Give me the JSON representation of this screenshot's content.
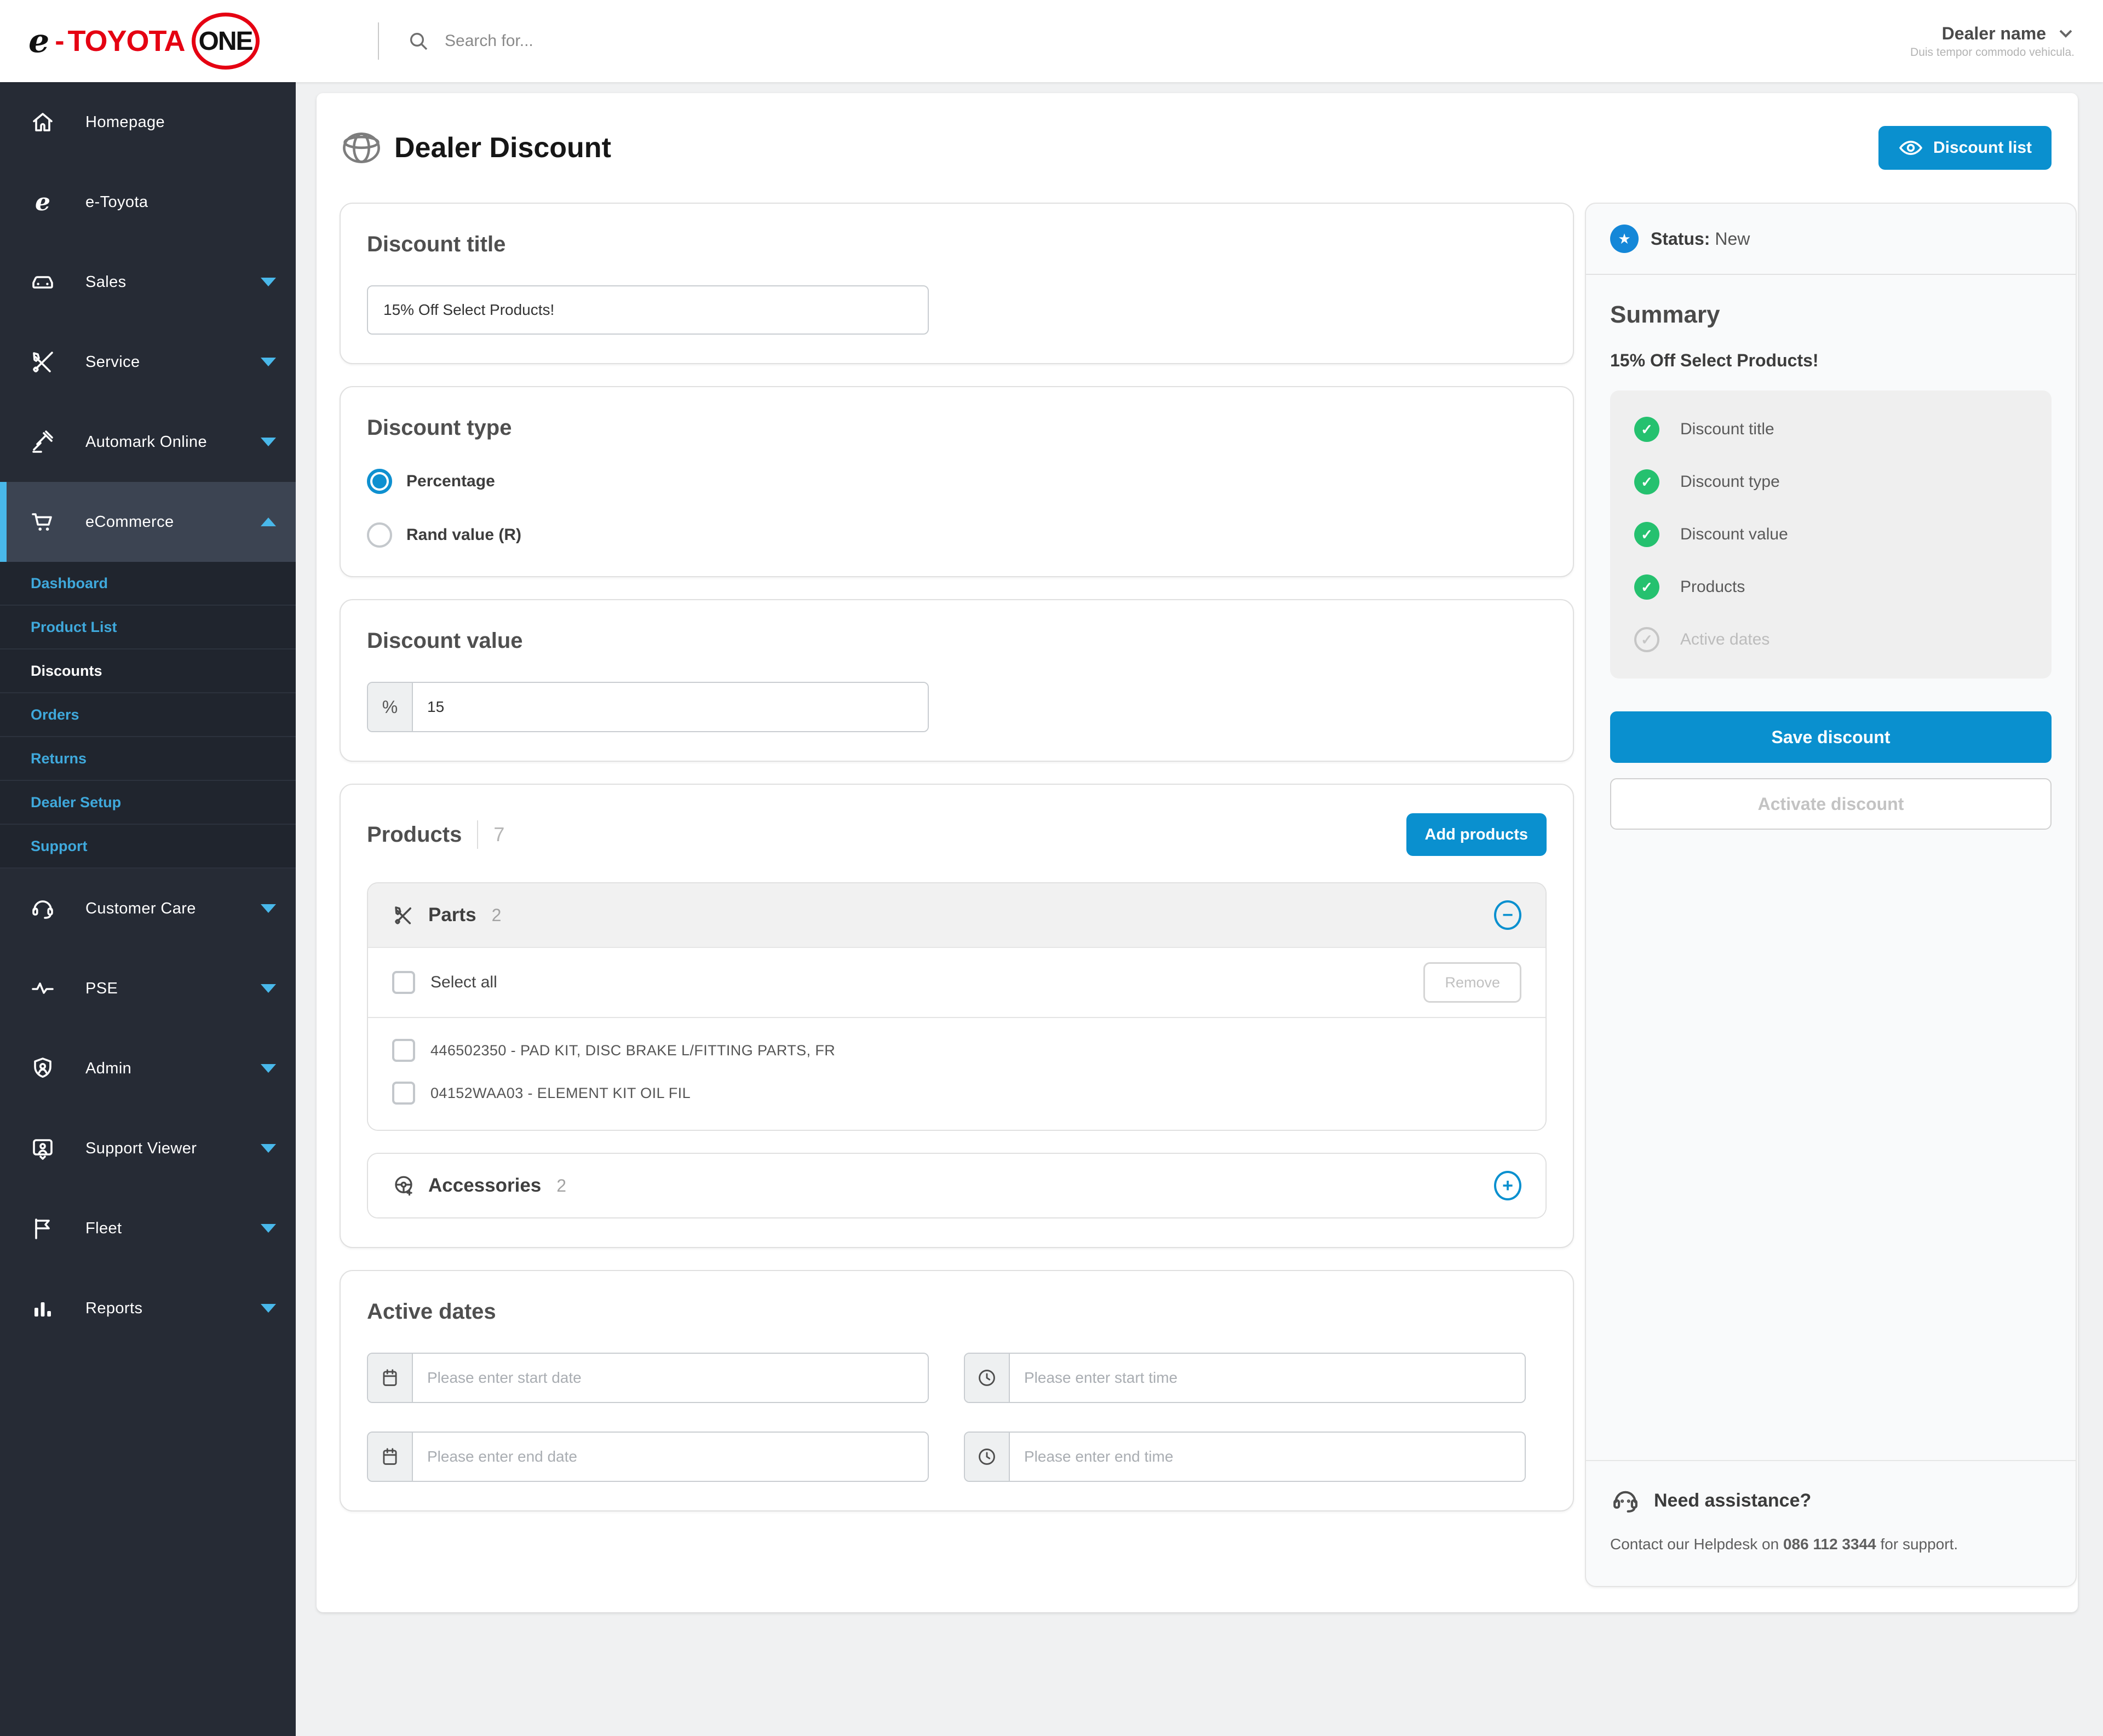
{
  "topbar": {
    "logo": {
      "e": "e",
      "dash": "-",
      "toyota": "TOYOTA",
      "one": "ONE"
    },
    "search_placeholder": "Search for...",
    "dealer_name": "Dealer name",
    "dealer_subtitle": "Duis tempor commodo vehicula."
  },
  "sidebar": {
    "items": [
      {
        "label": "Homepage"
      },
      {
        "label": "e-Toyota"
      },
      {
        "label": "Sales"
      },
      {
        "label": "Service"
      },
      {
        "label": "Automark Online"
      },
      {
        "label": "eCommerce"
      }
    ],
    "sub_items": [
      {
        "label": "Dashboard"
      },
      {
        "label": "Product List"
      },
      {
        "label": "Discounts"
      },
      {
        "label": "Orders"
      },
      {
        "label": "Returns"
      },
      {
        "label": "Dealer Setup"
      },
      {
        "label": "Support"
      }
    ],
    "items_bottom": [
      {
        "label": "Customer Care"
      },
      {
        "label": "PSE"
      },
      {
        "label": "Admin"
      },
      {
        "label": "Support Viewer"
      },
      {
        "label": "Fleet"
      },
      {
        "label": "Reports"
      }
    ]
  },
  "page": {
    "title": "Dealer Discount",
    "discount_list_label": "Discount list"
  },
  "form": {
    "discount_title": {
      "heading": "Discount title",
      "value": "15% Off Select Products!"
    },
    "discount_type": {
      "heading": "Discount type",
      "options": [
        {
          "label": "Percentage",
          "selected": true
        },
        {
          "label": "Rand value (R)",
          "selected": false
        }
      ]
    },
    "discount_value": {
      "heading": "Discount value",
      "prefix": "%",
      "value": "15"
    },
    "products": {
      "heading": "Products",
      "count": "7",
      "add_label": "Add products",
      "parts": {
        "title": "Parts",
        "count": "2",
        "select_all_label": "Select all",
        "remove_label": "Remove",
        "items": [
          "446502350 - PAD KIT, DISC BRAKE L/FITTING PARTS, FR",
          "04152WAA03 - ELEMENT KIT OIL FIL"
        ]
      },
      "accessories": {
        "title": "Accessories",
        "count": "2"
      }
    },
    "active_dates": {
      "heading": "Active dates",
      "start_date_placeholder": "Please enter start date",
      "start_time_placeholder": "Please enter start time",
      "end_date_placeholder": "Please enter end date",
      "end_time_placeholder": "Please enter end time"
    }
  },
  "summary_panel": {
    "status_label": "Status:",
    "status_value": "New",
    "heading": "Summary",
    "subtitle": "15% Off Select Products!",
    "checklist": [
      {
        "label": "Discount title",
        "done": true
      },
      {
        "label": "Discount type",
        "done": true
      },
      {
        "label": "Discount value",
        "done": true
      },
      {
        "label": "Products",
        "done": true
      },
      {
        "label": "Active dates",
        "done": false
      }
    ],
    "save_label": "Save discount",
    "activate_label": "Activate discount",
    "assistance": {
      "heading": "Need assistance?",
      "text_before": "Contact our Helpdesk on ",
      "phone": "086 112 3344",
      "text_after": " for support."
    }
  },
  "colors": {
    "accent": "#0a90cf",
    "sidebar_link": "#3fa9dc",
    "chevron": "#49b8ea",
    "success": "#25c16f",
    "brand_red": "#e50012"
  }
}
